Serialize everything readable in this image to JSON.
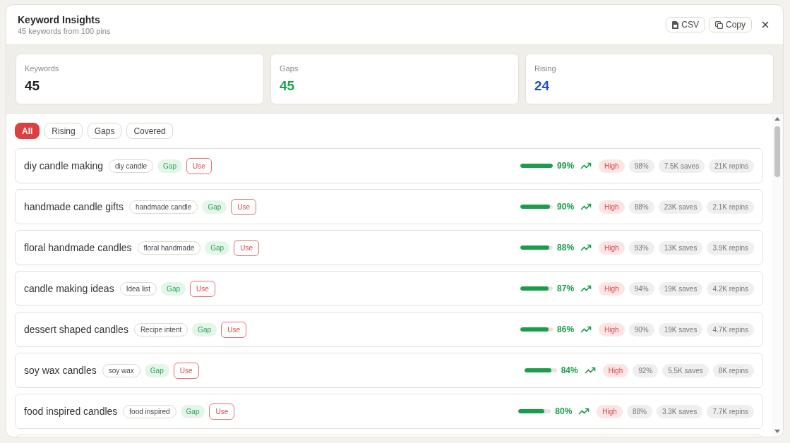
{
  "header": {
    "title": "Keyword Insights",
    "subtitle": "45 keywords from 100 pins",
    "buttons": [
      {
        "kind": "csv",
        "label": "CSV"
      },
      {
        "kind": "copy",
        "label": "Copy"
      },
      {
        "kind": "close"
      }
    ]
  },
  "stats": [
    {
      "label": "Keywords",
      "value": "45",
      "color": "#222222"
    },
    {
      "label": "Gaps",
      "value": "45",
      "color": "#16a34a"
    },
    {
      "label": "Rising",
      "value": "24",
      "color": "#1d4ed8"
    }
  ],
  "filters": [
    {
      "label": "All",
      "selected": true
    },
    {
      "label": "Rising",
      "selected": false
    },
    {
      "label": "Gaps",
      "selected": false
    },
    {
      "label": "Covered",
      "selected": false
    }
  ],
  "keywords": [
    {
      "keyword": "diy candle making",
      "tag": "diy candle",
      "status": "Gap",
      "action": "Use",
      "level": 0.99,
      "score": "99%",
      "competition": "High",
      "match": "98%",
      "saves": "7.5K saves",
      "repins": "21K repins"
    },
    {
      "keyword": "handmade candle gifts",
      "tag": "handmade candle",
      "status": "Gap",
      "action": "Use",
      "level": 0.9,
      "score": "90%",
      "competition": "High",
      "match": "88%",
      "saves": "23K saves",
      "repins": "2.1K repins"
    },
    {
      "keyword": "floral handmade candles",
      "tag": "floral handmade",
      "status": "Gap",
      "action": "Use",
      "level": 0.88,
      "score": "88%",
      "competition": "High",
      "match": "93%",
      "saves": "13K saves",
      "repins": "3.9K repins"
    },
    {
      "keyword": "candle making ideas",
      "tag": "Idea list",
      "status": "Gap",
      "action": "Use",
      "level": 0.87,
      "score": "87%",
      "competition": "High",
      "match": "94%",
      "saves": "19K saves",
      "repins": "4.2K repins"
    },
    {
      "keyword": "dessert shaped candles",
      "tag": "Recipe intent",
      "status": "Gap",
      "action": "Use",
      "level": 0.86,
      "score": "86%",
      "competition": "High",
      "match": "90%",
      "saves": "19K saves",
      "repins": "4.7K repins"
    },
    {
      "keyword": "soy wax candles",
      "tag": "soy wax",
      "status": "Gap",
      "action": "Use",
      "level": 0.84,
      "score": "84%",
      "competition": "High",
      "match": "92%",
      "saves": "5.5K saves",
      "repins": "8K repins"
    },
    {
      "keyword": "food inspired candles",
      "tag": "food inspired",
      "status": "Gap",
      "action": "Use",
      "level": 0.8,
      "score": "80%",
      "competition": "High",
      "match": "88%",
      "saves": "3.3K saves",
      "repins": "7.7K repins"
    }
  ]
}
